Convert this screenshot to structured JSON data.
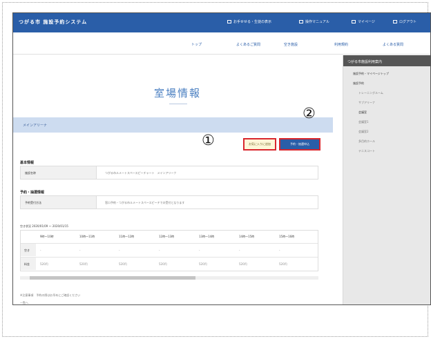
{
  "header": {
    "brand": "つがる市 施設予約システム",
    "links": [
      "お手せせる・生徒の表示",
      "操作マニュアル",
      "マイページ",
      "ログアウト"
    ]
  },
  "nav": [
    "トップ",
    "よくあるご質問",
    "空き施設",
    "利用規約",
    "よくある質問"
  ],
  "page_title": "室場情報",
  "facility_banner": "メインアリーナ",
  "buttons": {
    "favorite": "お気に入りに追加",
    "reserve": "予約・抽選申込"
  },
  "markers": [
    "①",
    "②"
  ],
  "sections": {
    "basic_label": "基本情報",
    "basic_key": "施設名称",
    "basic_value": "つがる市ルメートスペースピーチャート　メインアリーナ",
    "reserve_label": "予約・抽選情報",
    "reserve_key": "予約受付方法",
    "reserve_value": "窓口予約・つがる市ルメートスペースピーチでの受付となります"
  },
  "availability": {
    "date_label": "空き状況 2020/01/09 〜 2020/01/15",
    "columns": [
      "9時〜10時",
      "10時〜11時",
      "11時〜12時",
      "12時〜13時",
      "13時〜14時",
      "14時〜15時",
      "15時〜16時"
    ],
    "rows": [
      {
        "label": "空き",
        "cells": [
          "-",
          "-",
          "-",
          "-",
          "-",
          "-",
          "-"
        ]
      },
      {
        "label": "料金",
        "cells": [
          "520円",
          "520円",
          "520円",
          "520円",
          "520円",
          "520円",
          "520円"
        ]
      }
    ]
  },
  "footnotes": [
    "※注意事項　予約の際はお早めにご確認ください",
    "一覧へ"
  ],
  "sidebar": {
    "title": "つがる市施設利用案内",
    "items": [
      {
        "label": "施設予約・マイページトップ",
        "bold": true
      },
      {
        "label": "施設予約",
        "bold": true
      },
      {
        "label": "トレーニングルーム",
        "bold": false
      },
      {
        "label": "サブアリーナ",
        "bold": false
      },
      {
        "label": "会議室",
        "bold": true
      },
      {
        "label": "会議室1",
        "bold": false
      },
      {
        "label": "会議室2",
        "bold": false
      },
      {
        "label": "多目的ホール",
        "bold": false
      },
      {
        "label": "テニスコート",
        "bold": false
      }
    ]
  }
}
